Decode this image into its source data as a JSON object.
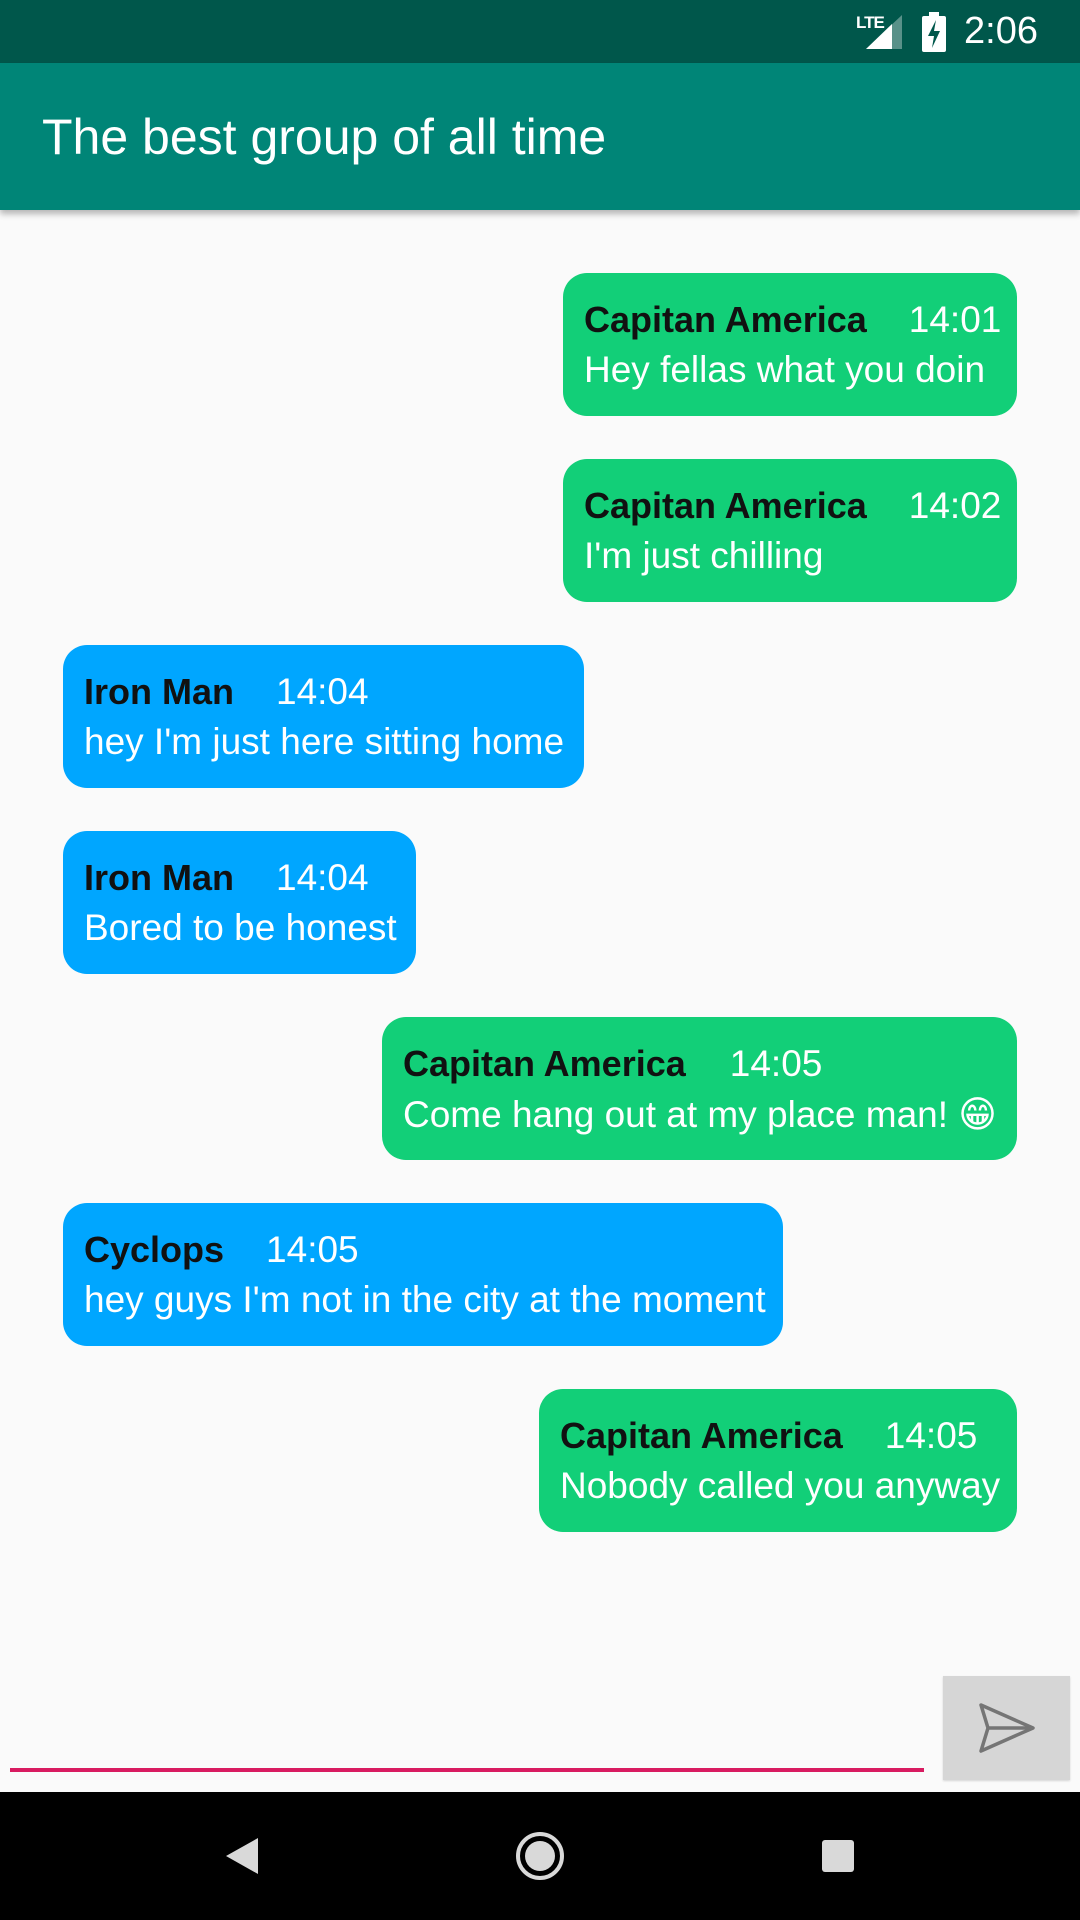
{
  "status_bar": {
    "network": "LTE",
    "time": "2:06"
  },
  "app_bar": {
    "title": "The best group of all time"
  },
  "messages": [
    {
      "sender": "Capitan America",
      "time": "14:01",
      "text": "Hey fellas what you doin",
      "side": "sent"
    },
    {
      "sender": "Capitan America",
      "time": "14:02",
      "text": "I'm just chilling",
      "side": "sent"
    },
    {
      "sender": "Iron Man",
      "time": "14:04",
      "text": "hey I'm just here sitting home",
      "side": "received"
    },
    {
      "sender": "Iron Man",
      "time": "14:04",
      "text": "Bored to be honest",
      "side": "received"
    },
    {
      "sender": "Capitan America",
      "time": "14:05",
      "text": "Come hang out at my place man!",
      "emoji": "😁",
      "side": "sent"
    },
    {
      "sender": "Cyclops",
      "time": "14:05",
      "text": "hey guys I'm not in the city at the moment",
      "side": "received"
    },
    {
      "sender": "Capitan America",
      "time": "14:05",
      "text": "Nobody called you anyway",
      "side": "sent"
    }
  ],
  "composer": {
    "value": "",
    "placeholder": "",
    "send_icon": "send-icon"
  },
  "colors": {
    "status_bar": "#00574b",
    "app_bar": "#008577",
    "sent_bubble": "#12cf78",
    "received_bubble": "#00a6ff",
    "input_underline": "#d81b60"
  }
}
